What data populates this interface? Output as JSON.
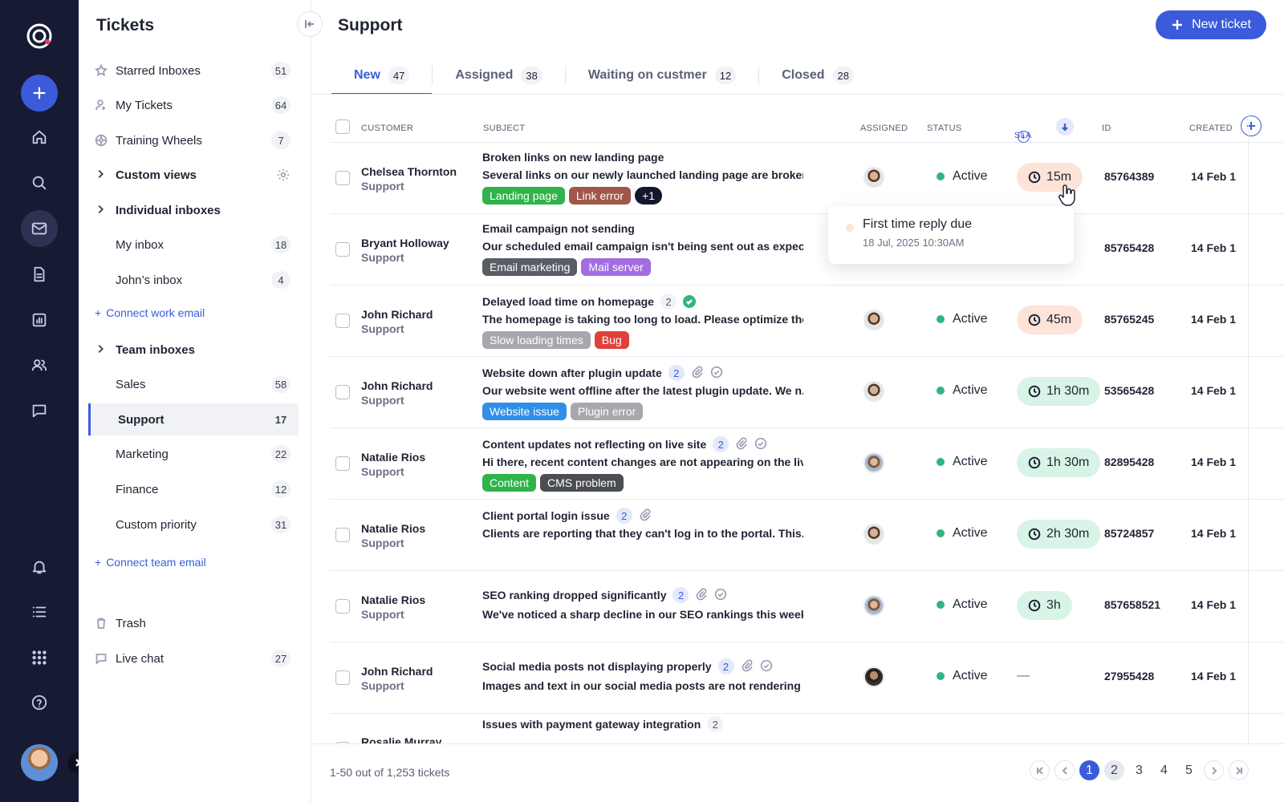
{
  "sidebar": {
    "title": "Tickets",
    "items": [
      {
        "label": "Starred Inboxes",
        "count": "51",
        "icon": "star-icon"
      },
      {
        "label": "My Tickets",
        "count": "64",
        "icon": "user-icon"
      },
      {
        "label": "Training Wheels",
        "count": "7",
        "icon": "wheel-icon"
      }
    ],
    "custom_views": "Custom views",
    "individual_inboxes": "Individual inboxes",
    "individual": [
      {
        "label": "My inbox",
        "count": "18"
      },
      {
        "label": "John’s inbox",
        "count": "4"
      }
    ],
    "connect_work_email": "Connect work email",
    "team_inboxes": "Team inboxes",
    "team": [
      {
        "label": "Sales",
        "count": "58"
      },
      {
        "label": "Support",
        "count": "17"
      },
      {
        "label": "Marketing",
        "count": "22"
      },
      {
        "label": "Finance",
        "count": "12"
      },
      {
        "label": "Custom priority",
        "count": "31"
      }
    ],
    "connect_team_email": "Connect team email",
    "trash": "Trash",
    "live_chat": {
      "label": "Live chat",
      "count": "27"
    }
  },
  "header": {
    "title": "Support",
    "new_ticket": "New ticket"
  },
  "tabs": [
    {
      "label": "New",
      "count": "47"
    },
    {
      "label": "Assigned",
      "count": "38"
    },
    {
      "label": "Waiting on custmer",
      "count": "12"
    },
    {
      "label": "Closed",
      "count": "28"
    }
  ],
  "columns": {
    "customer": "CUSTOMER",
    "subject": "SUBJECT",
    "assigned": "ASSIGNED",
    "status": "STATUS",
    "sla": "SLA",
    "id": "ID",
    "created": "CREATED"
  },
  "tickets": [
    {
      "customer": "Chelsea Thornton",
      "team": "Support",
      "subject": "Broken links on new landing page",
      "desc": "Several links on our newly launched landing page are broken....",
      "tags": [
        {
          "label": "Landing page",
          "color": "#2fb34a"
        },
        {
          "label": "Link error",
          "color": "#a0574a"
        },
        {
          "label": "+1",
          "color": "#12172b"
        }
      ],
      "status": "Active",
      "sla": "15m",
      "id": "85764389",
      "created": "14 Feb 1"
    },
    {
      "customer": "Bryant Holloway",
      "team": "Support",
      "subject": "Email campaign not sending",
      "desc": "Our scheduled email campaign isn't being sent out as expect...",
      "tags": [
        {
          "label": "Email marketing",
          "color": "#5a5d66"
        },
        {
          "label": "Mail server",
          "color": "#a36ce0"
        }
      ],
      "status": "Active",
      "sla": "",
      "id": "85765428",
      "created": "14 Feb 1"
    },
    {
      "customer": "John Richard",
      "team": "Support",
      "subject": "Delayed load time on homepage",
      "count": "2",
      "desc": "The homepage is taking too long to load. Please optimize the...",
      "tags": [
        {
          "label": "Slow loading times",
          "color": "#a6a8ae"
        },
        {
          "label": "Bug",
          "color": "#e0413b"
        }
      ],
      "status": "Active",
      "sla": "45m",
      "id": "85765245",
      "created": "14 Feb 1"
    },
    {
      "customer": "John Richard",
      "team": "Support",
      "subject": "Website down after plugin update",
      "count": "2",
      "desc": "Our website went offline after the latest plugin update. We n...",
      "tags": [
        {
          "label": "Website issue",
          "color": "#2f8fe8"
        },
        {
          "label": "Plugin error",
          "color": "#a6a8ae"
        }
      ],
      "status": "Active",
      "sla": "1h 30m",
      "id": "53565428",
      "created": "14 Feb 1"
    },
    {
      "customer": "Natalie Rios",
      "team": "Support",
      "subject": "Content updates not reflecting on live site",
      "count": "2",
      "desc": "Hi there, recent content changes are not appearing on the liv...",
      "tags": [
        {
          "label": "Content",
          "color": "#2fb34a"
        },
        {
          "label": "CMS problem",
          "color": "#4b4d55"
        }
      ],
      "status": "Active",
      "sla": "1h 30m",
      "id": "82895428",
      "created": "14 Feb 1"
    },
    {
      "customer": "Natalie Rios",
      "team": "Support",
      "subject": "Client portal login issue",
      "count": "2",
      "desc": "Clients are reporting that they can't log in to the portal. This...",
      "tags": [],
      "status": "Active",
      "sla": "2h 30m",
      "id": "85724857",
      "created": "14 Feb 1"
    },
    {
      "customer": "Natalie Rios",
      "team": "Support",
      "subject": "SEO ranking dropped significantly",
      "count": "2",
      "desc": "We've noticed a sharp decline in our SEO rankings this week....",
      "tags": [],
      "status": "Active",
      "sla": "3h",
      "id": "857658521",
      "created": "14 Feb 1"
    },
    {
      "customer": "John Richard",
      "team": "Support",
      "subject": "Social media posts not displaying properly",
      "count": "2",
      "desc": "Images and text in our social media posts are not rendering c...",
      "tags": [],
      "status": "Active",
      "sla": "—",
      "id": "27955428",
      "created": "14 Feb 1"
    },
    {
      "customer": "Rosalie Murray",
      "team": "Support",
      "subject": "Issues with payment gateway integration",
      "count": "2",
      "desc": "",
      "tags": [],
      "status": "",
      "sla": "",
      "id": "",
      "created": ""
    }
  ],
  "tooltip": {
    "title": "First time reply due",
    "date": "18 Jul, 2025 10:30AM"
  },
  "footer": {
    "summary": "1-50 out of 1,253 tickets",
    "pages": [
      "1",
      "2",
      "3",
      "4",
      "5"
    ]
  }
}
